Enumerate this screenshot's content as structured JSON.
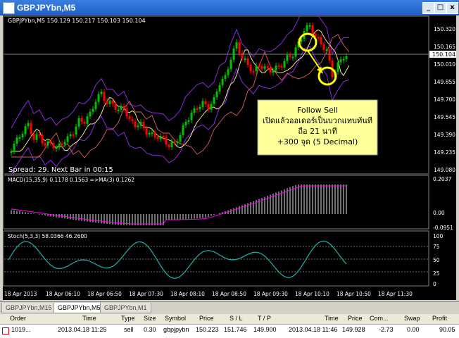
{
  "window": {
    "title": "GBPJPYbn,M5"
  },
  "chart": {
    "info": "GBPJPYbn,M5  150.129 150.217 150.103 150.104",
    "spread_text": "Spread: 29. Next Bar in 00:15",
    "price_ticks": [
      "150.320",
      "150.165",
      "150.104",
      "150.010",
      "149.855",
      "149.700",
      "149.545",
      "149.390",
      "149.235",
      "149.080"
    ],
    "current_price": "150.104",
    "annotation": [
      "Follow Sell",
      "เปิดแล้วออเดอร์เป็นบวกแทบทันที",
      "ถือ 21 นาที",
      "+300 จุด (5 Decimal)"
    ],
    "macd_label": "MACD(15,35,9) 0.1178 0.1563 =>MA(3) 0.1262",
    "macd_ticks": [
      "0.2037",
      "0.00",
      "-0.0951"
    ],
    "stoch_label": "Stoch(5,3,3) 58.0366 46.2600",
    "stoch_ticks": [
      "100",
      "75",
      "50",
      "25",
      "0"
    ],
    "time_ticks": [
      "18 Apr 2013",
      "18 Apr 06:10",
      "18 Apr 06:50",
      "18 Apr 07:30",
      "18 Apr 08:10",
      "18 Apr 08:50",
      "18 Apr 09:30",
      "18 Apr 10:10",
      "18 Apr 10:50",
      "18 Apr 11:30"
    ],
    "colors": {
      "bull": "#00c000",
      "bear": "#ff0000",
      "band": "#8a2be2",
      "annotation_bg": "#ffff99",
      "circle": "#ffff00",
      "stoch": "#20b2aa"
    }
  },
  "tabs": [
    {
      "label": "GBPJPYbn,M15",
      "active": false
    },
    {
      "label": "GBPJPYbn,M5",
      "active": true
    },
    {
      "label": "GBPJPYbn,M1",
      "active": false
    }
  ],
  "orders": {
    "columns": [
      "Order",
      "Time",
      "Type",
      "Size",
      "Symbol",
      "Price",
      "S / L",
      "T / P",
      "Time",
      "Price",
      "Com...",
      "Swap",
      "Profit"
    ],
    "rows": [
      [
        "1019...",
        "2013.04.18 11:25",
        "sell",
        "0.30",
        "gbpjpybn",
        "150.223",
        "151.746",
        "149.900",
        "2013.04.18 11:46",
        "149.928",
        "-2.73",
        "0.00",
        "90.05"
      ]
    ]
  }
}
